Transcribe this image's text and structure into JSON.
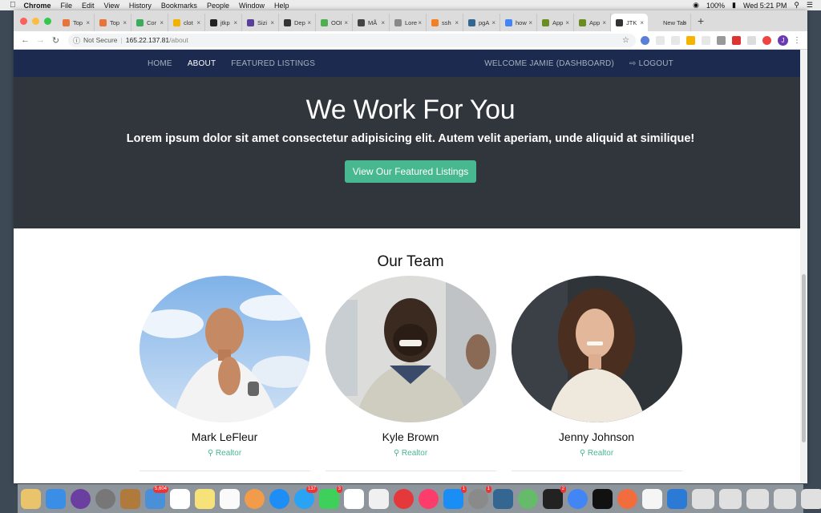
{
  "menubar": {
    "app": "Chrome",
    "items": [
      "File",
      "Edit",
      "View",
      "History",
      "Bookmarks",
      "People",
      "Window",
      "Help"
    ],
    "battery": "100%",
    "clock": "Wed 5:21 PM"
  },
  "browser": {
    "tabs": [
      {
        "label": "Top",
        "color": "#e8743b"
      },
      {
        "label": "Top",
        "color": "#e8743b"
      },
      {
        "label": "Cor",
        "color": "#3dab5c"
      },
      {
        "label": "clot",
        "color": "#f0b400"
      },
      {
        "label": "jtkp",
        "color": "#222222"
      },
      {
        "label": "Sizi",
        "color": "#5a3e9b"
      },
      {
        "label": "Dep",
        "color": "#333333"
      },
      {
        "label": "OOI",
        "color": "#4caf50"
      },
      {
        "label": "MÃ",
        "color": "#444444"
      },
      {
        "label": "Lore",
        "color": "#888888"
      },
      {
        "label": "ssh",
        "color": "#f48024"
      },
      {
        "label": "pgA",
        "color": "#336791"
      },
      {
        "label": "how",
        "color": "#4285f4"
      },
      {
        "label": "App",
        "color": "#6b8e23"
      },
      {
        "label": "App",
        "color": "#6b8e23"
      },
      {
        "label": "JTK",
        "color": "#333333",
        "active": true
      },
      {
        "label": "New Tab",
        "color": "#dcdcdc"
      }
    ],
    "url_security": "Not Secure",
    "url_host": "165.22.137.81",
    "url_path": "/about",
    "profile_initial": "J"
  },
  "site": {
    "nav": {
      "home": "HOME",
      "about": "ABOUT",
      "featured": "FEATURED LISTINGS",
      "welcome": "WELCOME JAMIE (DASHBOARD)",
      "logout": "LOGOUT"
    },
    "hero": {
      "title": "We Work For You",
      "lead": "Lorem ipsum dolor sit amet consectetur adipisicing elit. Autem velit aperiam, unde aliquid at similique!",
      "button": "View Our Featured Listings"
    },
    "team": {
      "heading": "Our Team",
      "members": [
        {
          "name": "Mark LeFleur",
          "role": "Realtor"
        },
        {
          "name": "Kyle Brown",
          "role": "Realtor"
        },
        {
          "name": "Jenny Johnson",
          "role": "Realtor"
        }
      ]
    }
  },
  "dock": {
    "badges": [
      "5,604",
      "137",
      "3",
      "1",
      "1",
      "2"
    ]
  }
}
